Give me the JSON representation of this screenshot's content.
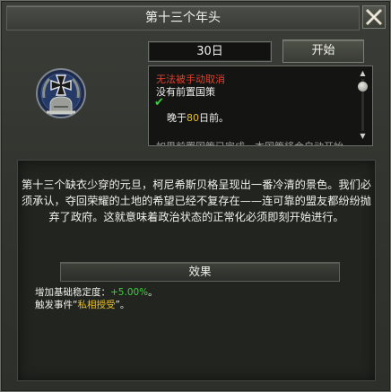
{
  "window": {
    "title": "第十三个年头"
  },
  "header": {
    "duration": "30日",
    "start_label": "开始"
  },
  "requirements": {
    "cannot_cancel": "无法被手动取消",
    "no_prerequisite": "没有前置国策",
    "check_mark": "✔",
    "before_prefix": "晚于",
    "before_days": "80",
    "before_suffix": "日前。",
    "cut_off_line": "如果前置国策已完成，本国策将会自动开始"
  },
  "description": {
    "text": "第十三个缺衣少穿的元旦，柯尼希斯贝格呈现出一番冷清的景色。我们必须承认，夺回荣耀的土地的希望已经不复存在——连可靠的盟友都纷纷抛弃了政府。这就意味着政治状态的正常化必须即刻开始进行。"
  },
  "effects": {
    "button_label": "效果",
    "stability_label": "增加基础稳定度：",
    "stability_value": "+5.00%",
    "stability_end": "。",
    "event_prefix": "触发事件“",
    "event_name": "私相授受",
    "event_suffix": "”。"
  },
  "colors": {
    "red": "#e0402c",
    "green": "#3fcf3f",
    "gold": "#e8c020"
  }
}
